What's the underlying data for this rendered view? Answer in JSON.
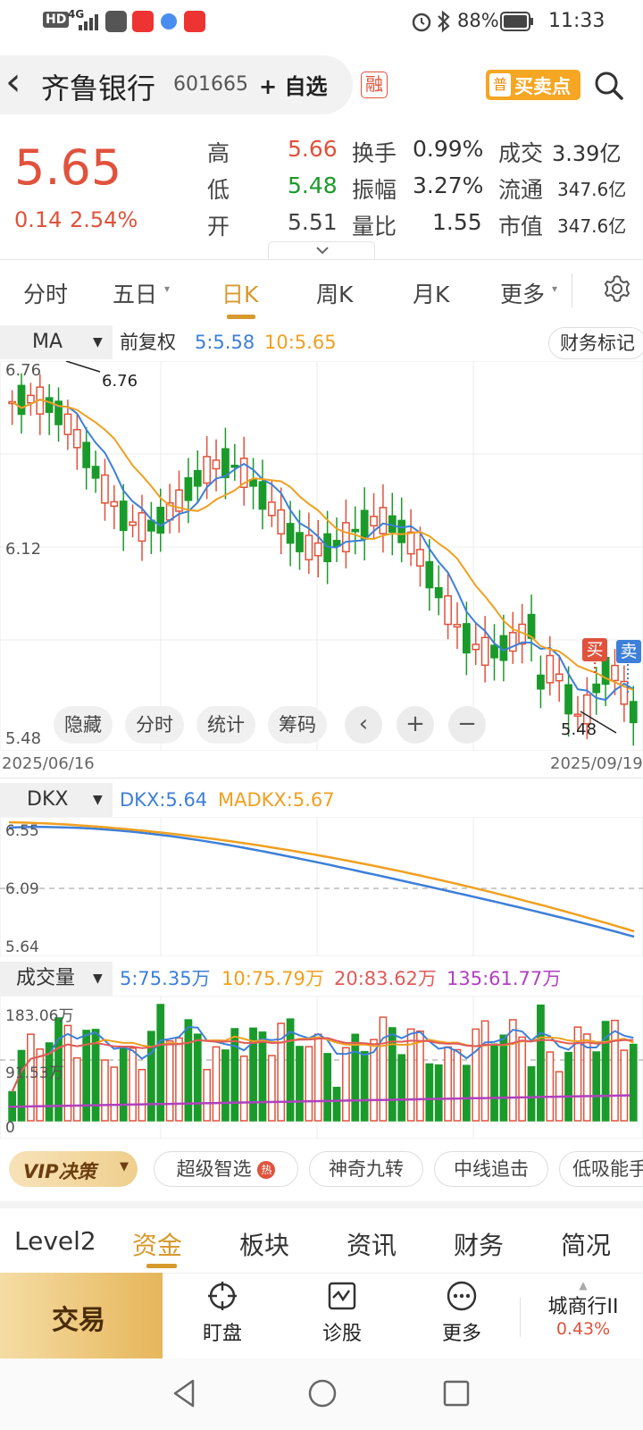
{
  "status": {
    "left_badge": "HD",
    "network": "4G",
    "battery": "88%",
    "time": "11:33"
  },
  "header": {
    "back": "‹",
    "stock_name": "齐鲁银行",
    "stock_code": "601665",
    "watch": "+ 自选",
    "margin_badge": "融",
    "buysell_badge": "普",
    "buysell": "买卖点"
  },
  "quote": {
    "price": "5.65",
    "change": "0.14",
    "change_pct": "2.54%",
    "high_label": "高",
    "high": "5.66",
    "low_label": "低",
    "low": "5.48",
    "open_label": "开",
    "open": "5.51",
    "turnover_label": "换手",
    "turnover": "0.99%",
    "amplitude_label": "振幅",
    "amplitude": "3.27%",
    "volratio_label": "量比",
    "volratio": "1.55",
    "amount_label": "成交",
    "amount": "3.39亿",
    "float_label": "流通",
    "float": "347.6亿",
    "mcap_label": "市值",
    "mcap": "347.6亿"
  },
  "tabs": [
    "分时",
    "五日",
    "日K",
    "周K",
    "月K",
    "更多"
  ],
  "active_tab": "日K",
  "ma_bar": {
    "selector": "MA",
    "adjust": "前复权",
    "ma5": "5:5.58",
    "ma10": "10:5.65",
    "finance": "财务标记"
  },
  "kline_chart": {
    "y_top": "6.76",
    "y_mid": "6.12",
    "y_bottom": "5.48",
    "high_mark": "6.76",
    "low_mark": "5.48",
    "date_start": "2025/06/16",
    "date_end": "2025/09/19",
    "buy_label": "买",
    "sell_label": "卖"
  },
  "tools": {
    "hide": "隐藏",
    "timeshare": "分时",
    "stats": "统计",
    "chips": "筹码"
  },
  "dkx": {
    "selector": "DKX",
    "dkx": "DKX:5.64",
    "madkx": "MADKX:5.67",
    "y_top": "6.55",
    "y_mid": "6.09",
    "y_bottom": "5.64"
  },
  "volume": {
    "selector": "成交量",
    "v5": "5:75.35万",
    "v10": "10:75.79万",
    "v20": "20:83.62万",
    "v135": "135:61.77万",
    "y_top": "183.06万",
    "y_mid": "91.53万",
    "y_bottom": "0"
  },
  "strategies": {
    "vip": "VIP决策",
    "items": [
      "超级智选",
      "神奇九转",
      "中线追击",
      "低吸能手"
    ],
    "hot": "热"
  },
  "bottom_tabs": [
    "Level2",
    "资金",
    "板块",
    "资讯",
    "财务",
    "简况"
  ],
  "active_bottom_tab": "资金",
  "nav": {
    "trade": "交易",
    "watch": "盯盘",
    "diagnose": "诊股",
    "more": "更多",
    "sector": "城商行II",
    "sector_pct": "0.43%"
  },
  "colors": {
    "up": "#e0523c",
    "down": "#1a9a2a",
    "ma5": "#3d7fd9",
    "ma10": "#f0a020",
    "ma20": "#e05a5a",
    "ma135": "#b040c0",
    "accent": "#e6b65a"
  }
}
